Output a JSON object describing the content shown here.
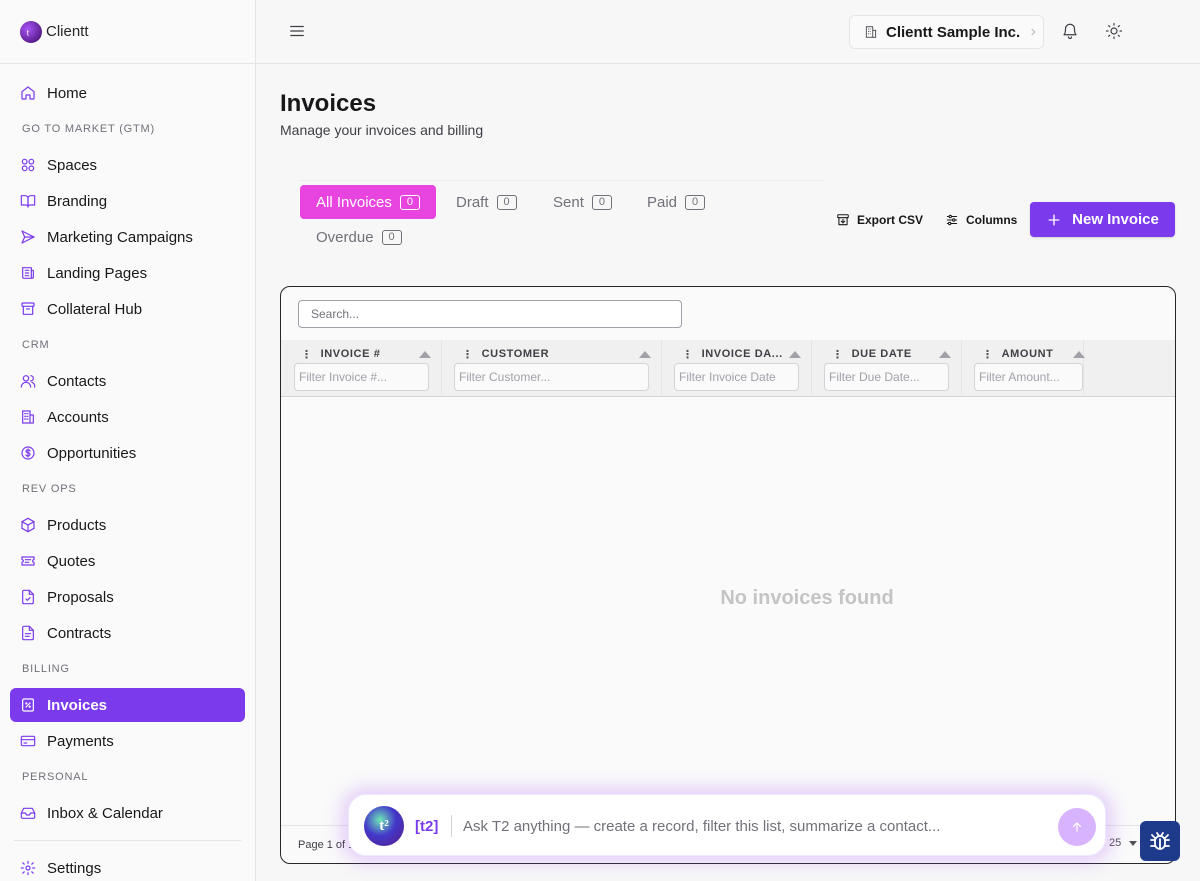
{
  "brand": {
    "name": "Clientt"
  },
  "sidebar": {
    "home": "Home",
    "sections": {
      "gtm": "GO TO MARKET (GTM)",
      "crm": "CRM",
      "revops": "REV OPS",
      "billing": "BILLING",
      "personal": "PERSONAL"
    },
    "items": {
      "spaces": "Spaces",
      "branding": "Branding",
      "marketing_campaigns": "Marketing Campaigns",
      "landing_pages": "Landing Pages",
      "collateral_hub": "Collateral Hub",
      "contacts": "Contacts",
      "accounts": "Accounts",
      "opportunities": "Opportunities",
      "products": "Products",
      "quotes": "Quotes",
      "proposals": "Proposals",
      "contracts": "Contracts",
      "invoices": "Invoices",
      "payments": "Payments",
      "inbox_calendar": "Inbox & Calendar",
      "settings": "Settings"
    }
  },
  "topbar": {
    "org_name": "Clientt Sample Inc."
  },
  "page": {
    "title": "Invoices",
    "subtitle": "Manage your invoices and billing"
  },
  "tabs": [
    {
      "label": "All Invoices",
      "count": "0"
    },
    {
      "label": "Draft",
      "count": "0"
    },
    {
      "label": "Sent",
      "count": "0"
    },
    {
      "label": "Paid",
      "count": "0"
    },
    {
      "label": "Overdue",
      "count": "0"
    }
  ],
  "actions": {
    "export": "Export CSV",
    "columns": "Columns",
    "new": "New Invoice"
  },
  "table": {
    "search_placeholder": "Search...",
    "columns": [
      {
        "label": "INVOICE #",
        "filter_placeholder": "Filter Invoice #..."
      },
      {
        "label": "CUSTOMER",
        "filter_placeholder": "Filter Customer..."
      },
      {
        "label": "INVOICE DA...",
        "filter_placeholder": "Filter Invoice Date"
      },
      {
        "label": "DUE DATE",
        "filter_placeholder": "Filter Due Date..."
      },
      {
        "label": "AMOUNT",
        "filter_placeholder": "Filter Amount..."
      }
    ],
    "empty_message": "No invoices found",
    "page_info": "Page 1 of 1",
    "page_size": "25"
  },
  "assistant": {
    "avatar_text": "t²",
    "tag": "[t2]",
    "placeholder": "Ask T2 anything — create a record, filter this list, summarize a contact..."
  }
}
